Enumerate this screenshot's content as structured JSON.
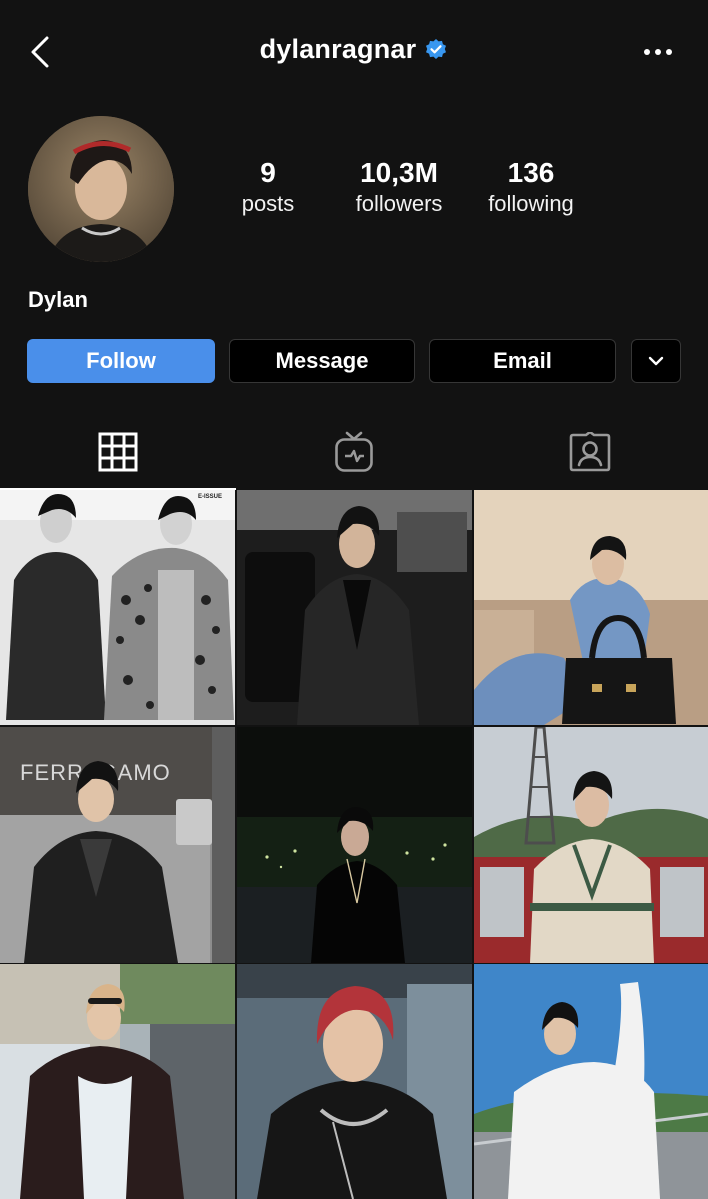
{
  "header": {
    "username": "dylanragnar",
    "verified": true,
    "back_icon": "chevron-left-icon",
    "more_icon": "more-horizontal-icon"
  },
  "profile": {
    "display_name": "Dylan",
    "stats": [
      {
        "value": "9",
        "label": "posts"
      },
      {
        "value": "10,3M",
        "label": "followers"
      },
      {
        "value": "136",
        "label": "following"
      }
    ]
  },
  "actions": {
    "follow": "Follow",
    "message": "Message",
    "email": "Email",
    "expand_icon": "chevron-down-icon"
  },
  "tabs": [
    {
      "name": "posts-grid",
      "icon": "grid-icon",
      "active": true
    },
    {
      "name": "igtv",
      "icon": "tv-icon",
      "active": false
    },
    {
      "name": "tagged",
      "icon": "tagged-person-icon",
      "active": false
    }
  ],
  "posts": [
    {
      "id": "post-1",
      "overlay_text": "E-ISSUE"
    },
    {
      "id": "post-2"
    },
    {
      "id": "post-3"
    },
    {
      "id": "post-4",
      "overlay_text": "FERRAGAMO"
    },
    {
      "id": "post-5"
    },
    {
      "id": "post-6"
    },
    {
      "id": "post-7"
    },
    {
      "id": "post-8"
    },
    {
      "id": "post-9"
    }
  ],
  "colors": {
    "background": "#121212",
    "follow_button": "#4a8fea",
    "verified_badge": "#3897f0"
  }
}
